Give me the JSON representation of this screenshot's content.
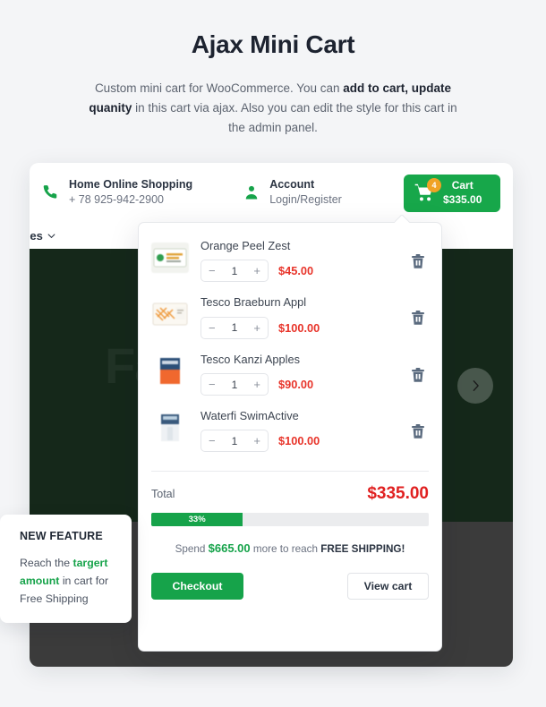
{
  "intro": {
    "title": "Ajax Mini Cart",
    "desc_part1": "Custom mini cart for WooCommerce. You can ",
    "desc_bold1": "add to cart, update quanity",
    "desc_part2": " in this cart via ajax. Also you can edit the style for this cart in the admin panel."
  },
  "topbar": {
    "phone_icon": "phone-icon",
    "shop_name": "Home Online Shopping",
    "phone_number": "+ 78 925-942-2900",
    "account_icon": "user-icon",
    "account_label": "Account",
    "account_sub": "Login/Register",
    "cart_icon": "shopping-cart-icon",
    "cart_badge": "4",
    "cart_label": "Cart",
    "cart_total": "$335.00"
  },
  "nav": {
    "item_label": "etables",
    "chevron": "chevron-down-icon"
  },
  "hero": {
    "headline": "Fa",
    "next_arrow": "chevron-right-icon"
  },
  "minicart": {
    "items": [
      {
        "name": "Orange Peel Zest",
        "qty": "1",
        "price": "$45.00",
        "minus": "−",
        "plus": "+",
        "remove": "trash-icon"
      },
      {
        "name": "Tesco Braeburn Appl",
        "qty": "1",
        "price": "$100.00",
        "minus": "−",
        "plus": "+",
        "remove": "trash-icon"
      },
      {
        "name": "Tesco Kanzi Apples",
        "qty": "1",
        "price": "$90.00",
        "minus": "−",
        "plus": "+",
        "remove": "trash-icon"
      },
      {
        "name": "Waterfi SwimActive",
        "qty": "1",
        "price": "$100.00",
        "minus": "−",
        "plus": "+",
        "remove": "trash-icon"
      }
    ],
    "total_label": "Total",
    "total_value": "$335.00",
    "progress_percent": 33,
    "progress_label": "33%",
    "shipping_prefix": "Spend ",
    "shipping_amount": "$665.00",
    "shipping_middle": " more to reach ",
    "shipping_suffix": "FREE SHIPPING!",
    "checkout_label": "Checkout",
    "viewcart_label": "View cart"
  },
  "feature": {
    "title": "NEW FEATURE",
    "body_part1": "Reach the ",
    "body_bold": "targert amount",
    "body_part2": " in cart for Free Shipping"
  },
  "colors": {
    "brand_green": "#16a34a",
    "cart_green": "#17a74a",
    "badge_orange": "#f0a225",
    "price_red": "#e8342a",
    "total_red": "#e02020",
    "hero_dark": "#15281a",
    "page_bg": "#f4f5f7"
  }
}
